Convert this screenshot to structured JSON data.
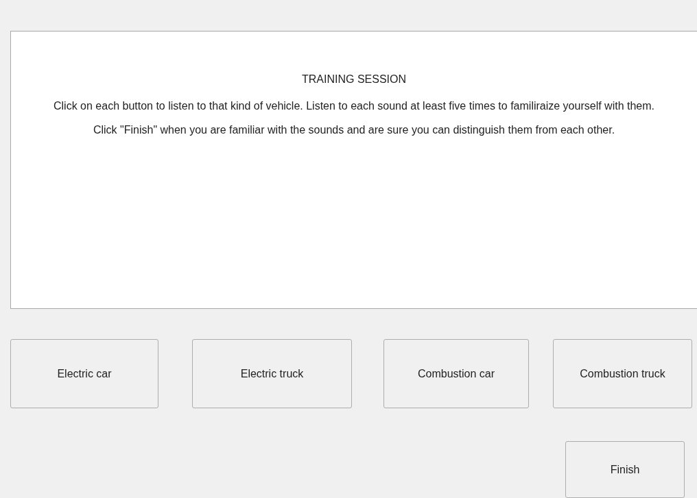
{
  "instructions": {
    "title": "TRAINING SESSION",
    "paragraphs": [
      "Click on each button to listen to that kind of vehicle. Listen to each sound at least five times to familiraize yourself with them.",
      "Click \"Finish\" when you are familiar with the sounds and are sure you can distinguish them from each other."
    ]
  },
  "sound_buttons": [
    "Electric car",
    "Electric truck",
    "Combustion car",
    "Combustion truck"
  ],
  "finish_button": "Finish"
}
